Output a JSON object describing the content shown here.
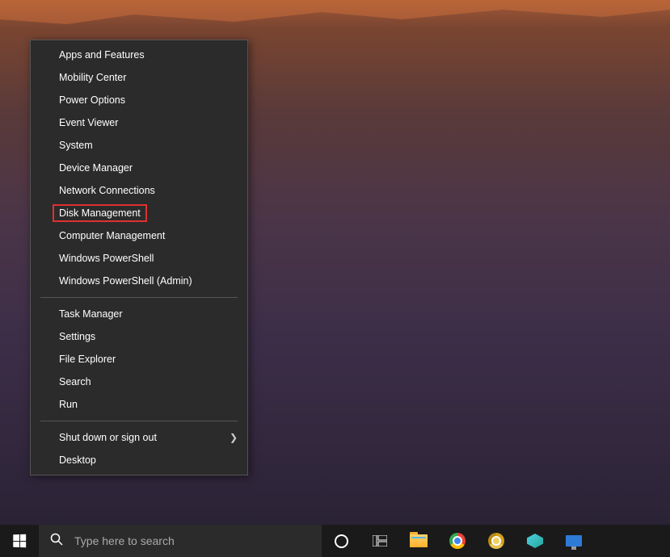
{
  "context_menu": {
    "groups": [
      [
        {
          "label": "Apps and Features",
          "name": "menu-apps-and-features"
        },
        {
          "label": "Mobility Center",
          "name": "menu-mobility-center"
        },
        {
          "label": "Power Options",
          "name": "menu-power-options"
        },
        {
          "label": "Event Viewer",
          "name": "menu-event-viewer"
        },
        {
          "label": "System",
          "name": "menu-system"
        },
        {
          "label": "Device Manager",
          "name": "menu-device-manager"
        },
        {
          "label": "Network Connections",
          "name": "menu-network-connections"
        },
        {
          "label": "Disk Management",
          "name": "menu-disk-management",
          "highlighted": true
        },
        {
          "label": "Computer Management",
          "name": "menu-computer-management"
        },
        {
          "label": "Windows PowerShell",
          "name": "menu-windows-powershell"
        },
        {
          "label": "Windows PowerShell (Admin)",
          "name": "menu-windows-powershell-admin"
        }
      ],
      [
        {
          "label": "Task Manager",
          "name": "menu-task-manager"
        },
        {
          "label": "Settings",
          "name": "menu-settings"
        },
        {
          "label": "File Explorer",
          "name": "menu-file-explorer"
        },
        {
          "label": "Search",
          "name": "menu-search"
        },
        {
          "label": "Run",
          "name": "menu-run"
        }
      ],
      [
        {
          "label": "Shut down or sign out",
          "name": "menu-shutdown-signout",
          "submenu": true
        },
        {
          "label": "Desktop",
          "name": "menu-desktop"
        }
      ]
    ]
  },
  "search_placeholder": "Type here to search"
}
